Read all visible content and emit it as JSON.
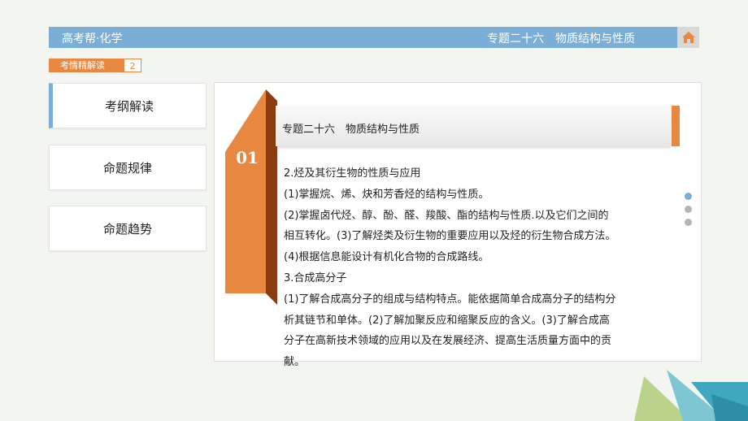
{
  "header": {
    "brand": "高考帮·化学",
    "topic": "专题二十六　物质结构与性质"
  },
  "home": {
    "icon": "home-icon",
    "color": "#e8873f"
  },
  "subtag": {
    "label": "考情精解读",
    "number": "2"
  },
  "nav": [
    {
      "label": "考纲解读",
      "active": true
    },
    {
      "label": "命题规律",
      "active": false
    },
    {
      "label": "命题趋势",
      "active": false
    }
  ],
  "ribbon": {
    "number": "01"
  },
  "panel": {
    "title": "专题二十六　物质结构与性质",
    "lines": [
      "2.烃及其衍生物的性质与应用",
      "(1)掌握烷、烯、炔和芳香烃的结构与性质。",
      "(2)掌握卤代烃、醇、酚、醛、羧酸、酯的结构与性质.以及它们之间的",
      "相互转化。(3)了解烃类及衍生物的重要应用以及烃的衍生物合成方法。",
      "(4)根据信息能设计有机化合物的合成路线。",
      "3.合成高分子",
      "(1)了解合成高分子的组成与结构特点。能依据简单合成高分子的结构分",
      "析其链节和单体。(2)了解加聚反应和缩聚反应的含义。(3)了解合成高",
      "分子在高新技术领域的应用以及在发展经济、提高生活质量方面中的贡",
      "献。"
    ]
  },
  "colors": {
    "header": "#7aaed6",
    "accent": "#e8873f",
    "background": "#f3f5f1"
  }
}
